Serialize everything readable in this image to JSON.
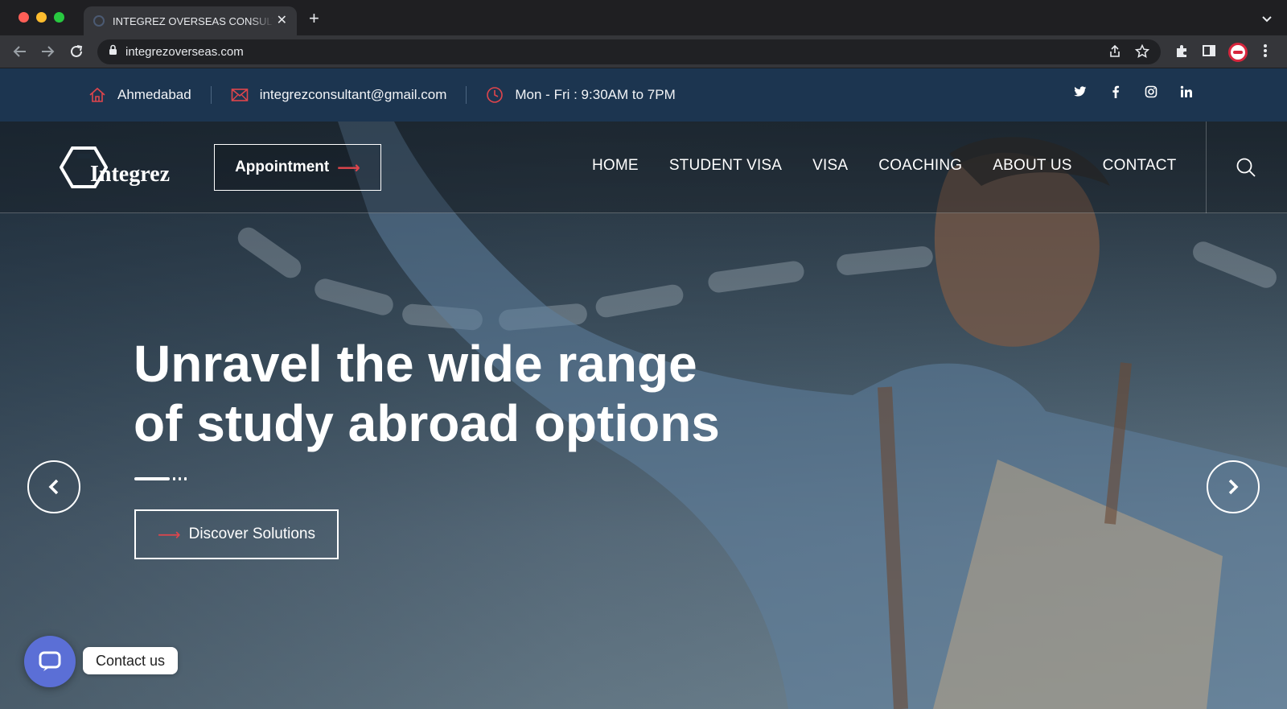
{
  "browser": {
    "tab_title": "INTEGREZ OVERSEAS CONSULTANT",
    "url": "integrezoverseas.com",
    "icons": [
      "back-icon",
      "forward-icon",
      "reload-icon",
      "lock-icon",
      "share-icon",
      "star-icon",
      "extensions-icon",
      "sidepanel-icon",
      "profile-avatar",
      "menu-icon"
    ]
  },
  "topbar": {
    "location": "Ahmedabad",
    "email": "integrezconsultant@gmail.com",
    "hours": "Mon - Fri : 9:30AM to 7PM",
    "socials": [
      "twitter",
      "facebook",
      "instagram",
      "linkedin"
    ]
  },
  "header": {
    "logo_text": "Integrez",
    "appointment_label": "Appointment",
    "nav": [
      "HOME",
      "STUDENT VISA",
      "VISA",
      "COACHING",
      "ABOUT US",
      "CONTACT"
    ]
  },
  "hero": {
    "headline_line1": "Unravel the wide range",
    "headline_line2": "of study abroad options",
    "cta_label": "Discover Solutions"
  },
  "chat": {
    "label": "Contact us"
  },
  "colors": {
    "topbar_bg": "#1c3550",
    "accent_red": "#e0454c",
    "chat_blue": "#5b6fd6"
  }
}
